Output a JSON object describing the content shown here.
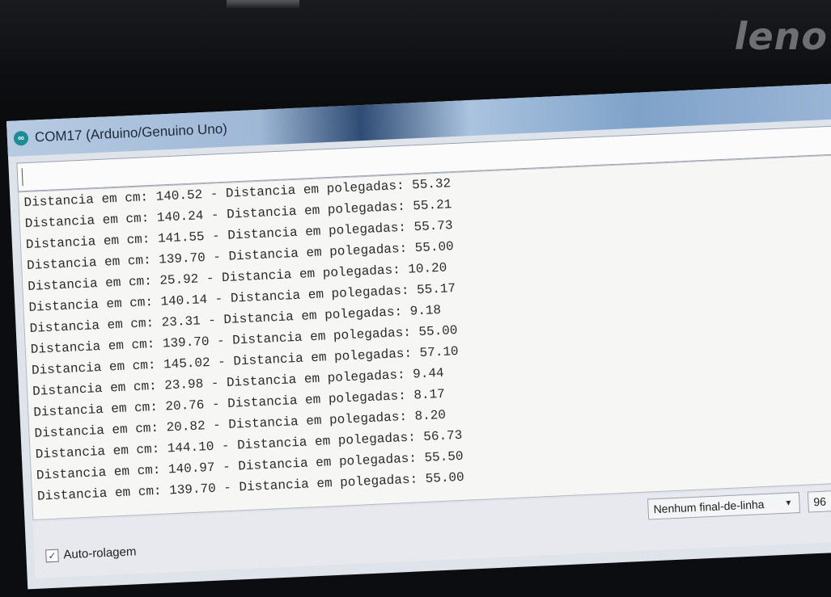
{
  "monitor": {
    "brand": "leno"
  },
  "window": {
    "title": "COM17 (Arduino/Genuino Uno)",
    "icon": "arduino-infinity-icon"
  },
  "send": {
    "value": ""
  },
  "output": {
    "lines": [
      "Distancia em cm: 140.52 - Distancia em polegadas: 55.32",
      "Distancia em cm: 140.24 - Distancia em polegadas: 55.21",
      "Distancia em cm: 141.55 - Distancia em polegadas: 55.73",
      "Distancia em cm: 139.70 - Distancia em polegadas: 55.00",
      "Distancia em cm: 25.92 - Distancia em polegadas: 10.20",
      "Distancia em cm: 140.14 - Distancia em polegadas: 55.17",
      "Distancia em cm: 23.31 - Distancia em polegadas: 9.18",
      "Distancia em cm: 139.70 - Distancia em polegadas: 55.00",
      "Distancia em cm: 145.02 - Distancia em polegadas: 57.10",
      "Distancia em cm: 23.98 - Distancia em polegadas: 9.44",
      "Distancia em cm: 20.76 - Distancia em polegadas: 8.17",
      "Distancia em cm: 20.82 - Distancia em polegadas: 8.20",
      "Distancia em cm: 144.10 - Distancia em polegadas: 56.73",
      "Distancia em cm: 140.97 - Distancia em polegadas: 55.50",
      "Distancia em cm: 139.70 - Distancia em polegadas: 55.00"
    ]
  },
  "bottom": {
    "autoscroll_label": "Auto-rolagem",
    "autoscroll_checked": true,
    "line_ending": "Nenhum final-de-linha",
    "baud": "96"
  }
}
